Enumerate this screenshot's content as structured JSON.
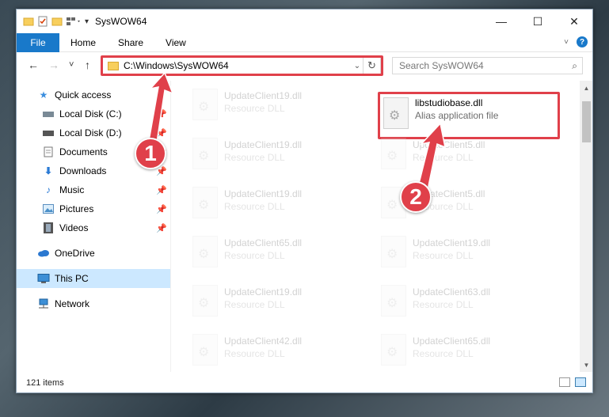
{
  "window": {
    "title": "SysWOW64",
    "minimize": "—",
    "maximize": "☐",
    "close": "✕"
  },
  "ribbon": {
    "file": "File",
    "tabs": [
      "Home",
      "Share",
      "View"
    ]
  },
  "nav": {
    "back": "←",
    "forward": "→",
    "recent": "˅",
    "up": "↑",
    "address": "C:\\Windows\\SysWOW64",
    "search_placeholder": "Search SysWOW64"
  },
  "sidebar": {
    "items": [
      {
        "label": "Quick access",
        "icon": "star-icon"
      },
      {
        "label": "Local Disk (C:)",
        "icon": "drive-icon",
        "pinned": true
      },
      {
        "label": "Local Disk (D:)",
        "icon": "drive-icon",
        "pinned": true
      },
      {
        "label": "Documents",
        "icon": "document-icon",
        "pinned": true
      },
      {
        "label": "Downloads",
        "icon": "download-icon",
        "pinned": true
      },
      {
        "label": "Music",
        "icon": "music-icon",
        "pinned": true
      },
      {
        "label": "Pictures",
        "icon": "pictures-icon",
        "pinned": true
      },
      {
        "label": "Videos",
        "icon": "video-icon",
        "pinned": true
      },
      {
        "label": "OneDrive",
        "icon": "cloud-icon"
      },
      {
        "label": "This PC",
        "icon": "computer-icon",
        "selected": true
      },
      {
        "label": "Network",
        "icon": "network-icon"
      }
    ]
  },
  "files": {
    "left": [
      {
        "name": "UpdateClient19.dll",
        "type": "Resource DLL"
      },
      {
        "name": "UpdateClient19.dll",
        "type": "Resource DLL"
      },
      {
        "name": "UpdateClient19.dll",
        "type": "Resource DLL"
      },
      {
        "name": "UpdateClient65.dll",
        "type": "Resource DLL"
      },
      {
        "name": "UpdateClient19.dll",
        "type": "Resource DLL"
      },
      {
        "name": "UpdateClient42.dll",
        "type": "Resource DLL"
      }
    ],
    "right": [
      {
        "name": "libstudiobase.dll",
        "type": "Alias application file"
      },
      {
        "name": "UpdateClient5.dll",
        "type": "Resource DLL"
      },
      {
        "name": "UpdateClient5.dll",
        "type": "Resource DLL"
      },
      {
        "name": "UpdateClient19.dll",
        "type": "Resource DLL"
      },
      {
        "name": "UpdateClient63.dll",
        "type": "Resource DLL"
      },
      {
        "name": "UpdateClient65.dll",
        "type": "Resource DLL"
      }
    ]
  },
  "status": {
    "count": "121 items"
  },
  "annotations": {
    "step1": "1",
    "step2": "2",
    "color": "#e0404a"
  }
}
